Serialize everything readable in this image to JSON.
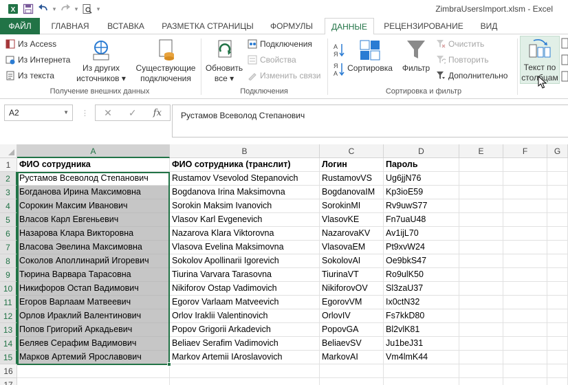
{
  "window": {
    "title": "ZimbraUsersImport.xlsm - Excel"
  },
  "tabs": [
    {
      "label": "ФАЙЛ"
    },
    {
      "label": "ГЛАВНАЯ"
    },
    {
      "label": "ВСТАВКА"
    },
    {
      "label": "РАЗМЕТКА СТРАНИЦЫ"
    },
    {
      "label": "ФОРМУЛЫ"
    },
    {
      "label": "ДАННЫЕ"
    },
    {
      "label": "РЕЦЕНЗИРОВАНИЕ"
    },
    {
      "label": "ВИД"
    }
  ],
  "active_tab": "ДАННЫЕ",
  "ribbon": {
    "external": {
      "group_label": "Получение внешних данных",
      "from_access": "Из Access",
      "from_web": "Из Интернета",
      "from_text": "Из текста",
      "other_line1": "Из других",
      "other_line2": "источников",
      "existing_line1": "Существующие",
      "existing_line2": "подключения"
    },
    "connections": {
      "group_label": "Подключения",
      "refresh_line1": "Обновить",
      "refresh_line2": "все",
      "connections": "Подключения",
      "properties": "Свойства",
      "edit_links": "Изменить связи"
    },
    "sort_filter": {
      "group_label": "Сортировка и фильтр",
      "sort": "Сортировка",
      "filter": "Фильтр",
      "clear": "Очистить",
      "reapply": "Повторить",
      "advanced": "Дополнительно"
    },
    "data_tools": {
      "text_to_columns_line1": "Текст по",
      "text_to_columns_line2": "столбцам"
    }
  },
  "formula_bar": {
    "name_box": "A2",
    "formula": "Рустамов Всеволод Степанович"
  },
  "sheet": {
    "columns": [
      "A",
      "B",
      "C",
      "D",
      "E",
      "F",
      "G"
    ],
    "rows": [
      [
        "ФИО сотрудника",
        "ФИО сотрудника (транслит)",
        "Логин",
        "Пароль"
      ],
      [
        "Рустамов Всеволод Степанович",
        "Rustamov Vsevolod Stepanovich",
        "RustamovVS",
        "Ug6jjN76"
      ],
      [
        "Богданова Ирина Максимовна",
        "Bogdanova Irina Maksimovna",
        "BogdanovaIM",
        "Kp3ioE59"
      ],
      [
        "Сорокин Максим Иванович",
        "Sorokin Maksim Ivanovich",
        "SorokinMI",
        "Rv9uwS77"
      ],
      [
        "Власов Карл Евгеньевич",
        "Vlasov Karl Evgenevich",
        "VlasovKE",
        "Fn7uaU48"
      ],
      [
        "Назарова Клара Викторовна",
        "Nazarova Klara Viktorovna",
        "NazarovaKV",
        "Av1ijL70"
      ],
      [
        "Власова Эвелина Максимовна",
        "Vlasova Evelina Maksimovna",
        "VlasovaEM",
        "Pt9xvW24"
      ],
      [
        "Соколов Аполлинарий Игоревич",
        "Sokolov Apollinarii Igorevich",
        "SokolovAI",
        "Oe9bkS47"
      ],
      [
        "Тюрина Варвара Тарасовна",
        "Tiurina Varvara Tarasovna",
        "TiurinaVT",
        "Ro9ulK50"
      ],
      [
        "Никифоров Остап Вадимович",
        "Nikiforov Ostap Vadimovich",
        "NikiforovOV",
        "Sl3zaU37"
      ],
      [
        "Егоров Варлаам Матвеевич",
        "Egorov Varlaam Matveevich",
        "EgorovVM",
        "Ix0ctN32"
      ],
      [
        "Орлов Ираклий Валентинович",
        "Orlov Iraklii Valentinovich",
        "OrlovIV",
        "Fs7kkD80"
      ],
      [
        "Попов Григорий Аркадьевич",
        "Popov Grigorii Arkadevich",
        "PopovGA",
        "Bl2vlK81"
      ],
      [
        "Беляев Серафим Вадимович",
        "Beliaev Serafim Vadimovich",
        "BeliaevSV",
        "Ju1beJ31"
      ],
      [
        "Марков Артемий Ярославович",
        "Markov Artemii IAroslavovich",
        "MarkovAI",
        "Vm4lmK44"
      ],
      [
        "",
        "",
        "",
        ""
      ],
      [
        "",
        "",
        "",
        ""
      ]
    ],
    "row_numbers": [
      "1",
      "2",
      "3",
      "4",
      "5",
      "6",
      "7",
      "8",
      "9",
      "10",
      "11",
      "12",
      "13",
      "14",
      "15",
      "16",
      "17"
    ]
  },
  "colors": {
    "accent": "#217346",
    "selection": "#c6c6c6"
  }
}
